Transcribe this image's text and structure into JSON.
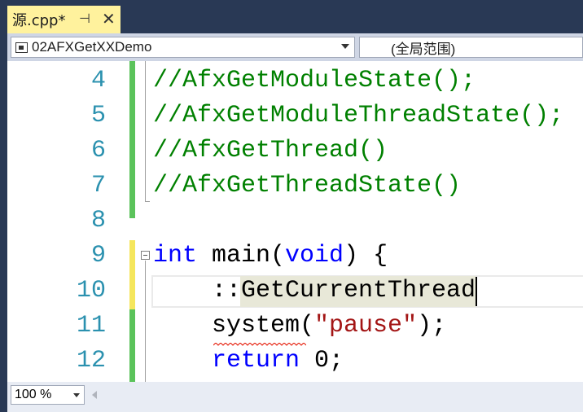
{
  "tab": {
    "title": "源.cpp*",
    "pin_glyph": "⊣",
    "close_glyph": "✕"
  },
  "nav": {
    "project": "02AFXGetXXDemo",
    "scope": "(全局范围)"
  },
  "editor": {
    "lines": [
      {
        "num": "4",
        "code": "//AfxGetModuleState();"
      },
      {
        "num": "5",
        "code": "//AfxGetModuleThreadState();"
      },
      {
        "num": "6",
        "code": "//AfxGetThread()"
      },
      {
        "num": "7",
        "code": "//AfxGetThreadState()"
      },
      {
        "num": "8",
        "code": ""
      },
      {
        "num": "9",
        "kw1": "int",
        "mid": " main(",
        "kw2": "void",
        "end": ") {"
      },
      {
        "num": "10",
        "code": "    ::GetCurrentThread"
      },
      {
        "num": "11",
        "pre": "    system(",
        "str": "\"pause\"",
        "post": ");"
      },
      {
        "num": "12",
        "kw": "return",
        "post": " 0;"
      }
    ]
  },
  "status": {
    "zoom": "100 %"
  },
  "colors": {
    "line_number": "#2b91af",
    "comment": "#008000",
    "keyword": "#0000ff",
    "string": "#a31515",
    "saved_change": "#5bc35b",
    "unsaved_change": "#f5e65c"
  }
}
